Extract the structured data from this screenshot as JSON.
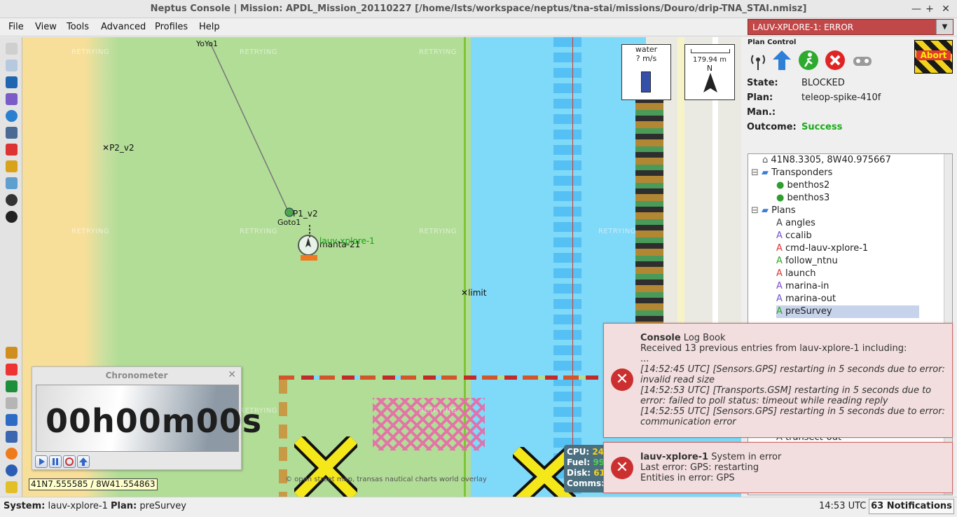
{
  "window": {
    "title": "Neptus Console | Mission: APDL_Mission_20110227 [/home/lsts/workspace/neptus/tna-stai/missions/Douro/drip-TNA_STAI.nmisz]",
    "minimize": "—",
    "maximize": "+",
    "close": "✕"
  },
  "menu": [
    "File",
    "View",
    "Tools",
    "Advanced",
    "Profiles",
    "Help"
  ],
  "system_status": {
    "value": "LAUV-XPLORE-1: ERROR",
    "arrow": "▼"
  },
  "map": {
    "retrying": "RETRYING",
    "labels": {
      "yoyo": "YoYo1",
      "p2": "P2_v2",
      "p1": "P1_v2",
      "goto": "Goto1",
      "manta": "manta-21",
      "vehicle": "lauv-xplore-1",
      "limit": "limit"
    },
    "legend_water": "water",
    "legend_speed": "? m/s",
    "scale": "179.94 m",
    "north": "N",
    "attribution": "© open street map, transas nautical charts world overlay",
    "vehicle_info": {
      "cpu": "CPU:",
      "cpu_val": "24",
      "fuel": "Fuel:",
      "fuel_val": "99",
      "disk": "Disk:",
      "disk_val": "61",
      "comms": "Comms:"
    }
  },
  "chronometer": {
    "title": "Chronometer",
    "time": "00h00m00s",
    "close": "✕"
  },
  "coords": "41N7.555585 / 8W41.554863",
  "plan_control": {
    "title": "Plan Control",
    "abort": "Abort",
    "state_label": "State:",
    "state": "BLOCKED",
    "plan_label": "Plan:",
    "plan": "teleop-spike-410f",
    "man_label": "Man.:",
    "man": "",
    "outcome_label": "Outcome:",
    "outcome": "Success"
  },
  "tree": {
    "home": "41N8.3305, 8W40.975667",
    "transponders": "Transponders",
    "transponder_items": [
      "benthos2",
      "benthos3"
    ],
    "plans": "Plans",
    "plan_items": [
      "angles",
      "ccalib",
      "cmd-lauv-xplore-1",
      "follow_ntnu",
      "launch",
      "marina-in",
      "marina-out",
      "preSurvey"
    ],
    "partial_bottom": "transect-out"
  },
  "notifications": [
    {
      "title_bold": "Console",
      "title_rest": " Log Book",
      "lines": [
        "Received 13 previous entries from lauv-xplore-1 including:",
        "...",
        "[14:52:45 UTC] [Sensors.GPS] restarting in 5 seconds due to error:",
        "invalid read size",
        "[14:52:53 UTC] [Transports.GSM] restarting in 5 seconds due to",
        "error: failed to poll status: timeout while reading reply",
        "[14:52:55 UTC] [Sensors.GPS] restarting in 5 seconds due to error:",
        "communication error"
      ]
    },
    {
      "title_bold": "lauv-xplore-1",
      "title_rest": " System in error",
      "lines": [
        "Last error: GPS: restarting",
        "Entities in error: GPS"
      ]
    }
  ],
  "statusbar": {
    "system_label": "System:",
    "system": "lauv-xplore-1",
    "plan_label": "Plan:",
    "plan": "preSurvey",
    "time": "14:53 UTC",
    "notifications": "63 Notifications"
  }
}
